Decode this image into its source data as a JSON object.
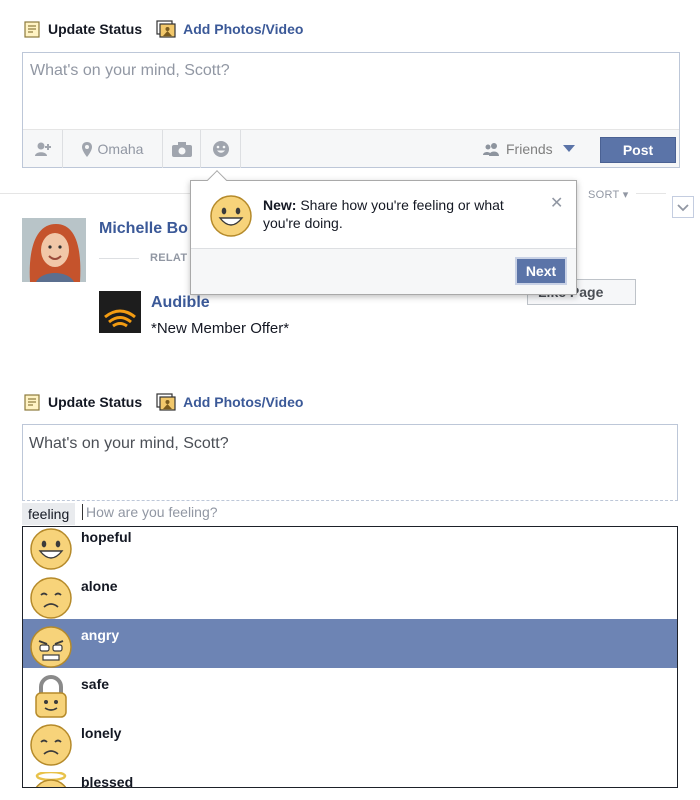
{
  "top_composer": {
    "tab_update_status": "Update Status",
    "tab_add_photos": "Add Photos/Video",
    "placeholder": "What's on your mind, Scott?",
    "location": "Omaha",
    "audience": "Friends",
    "post_label": "Post"
  },
  "tooltip": {
    "new_label": "New:",
    "message": " Share how you're feeling or what you're doing.",
    "close_glyph": "✕",
    "next_label": "Next"
  },
  "feed": {
    "sort_label": "SORT ▾",
    "person_name": "Michelle Bo",
    "related_label": "RELAT",
    "page_name": "Audible",
    "page_offer": "*New Member Offer*",
    "like_page_label": "Like Page"
  },
  "bottom_composer": {
    "tab_update_status": "Update Status",
    "tab_add_photos": "Add Photos/Video",
    "placeholder": "What's on your mind, Scott?",
    "feeling_chip": "feeling",
    "feeling_placeholder": "How are you feeling?",
    "options": [
      {
        "label": "hopeful",
        "icon": "smile-icon"
      },
      {
        "label": "alone",
        "icon": "sad-icon"
      },
      {
        "label": "angry",
        "icon": "angry-icon"
      },
      {
        "label": "safe",
        "icon": "lock-icon"
      },
      {
        "label": "lonely",
        "icon": "sad-icon"
      },
      {
        "label": "blessed",
        "icon": "halo-icon"
      }
    ],
    "selected_option": "angry"
  },
  "colors": {
    "facebook_blue": "#3b5998",
    "button_blue": "#5b74a8",
    "selected_row": "#6d84b4",
    "emoji_yellow": "#f7d37a"
  }
}
